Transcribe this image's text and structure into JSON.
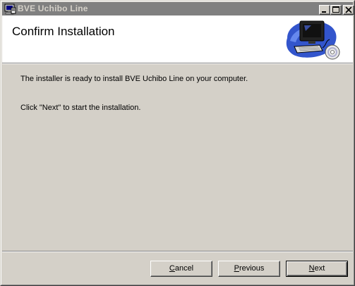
{
  "window": {
    "title": "BVE Uchibo Line",
    "controls": {
      "minimize_icon": "minimize-icon",
      "maximize_icon": "maximize-icon",
      "close_icon": "close-icon"
    }
  },
  "header": {
    "title": "Confirm Installation",
    "art_icon": "computer-install-icon"
  },
  "body": {
    "line1": "The installer is ready to install BVE Uchibo Line on your computer.",
    "line2": "Click \"Next\" to start the installation."
  },
  "buttons": {
    "cancel": {
      "mnemonic": "C",
      "rest": "ancel"
    },
    "previous": {
      "mnemonic": "P",
      "rest": "revious"
    },
    "next": {
      "mnemonic": "N",
      "rest": "ext"
    }
  },
  "colors": {
    "face": "#d4d0c8",
    "titlebar_inactive": "#808080",
    "header_bg": "#ffffff"
  }
}
